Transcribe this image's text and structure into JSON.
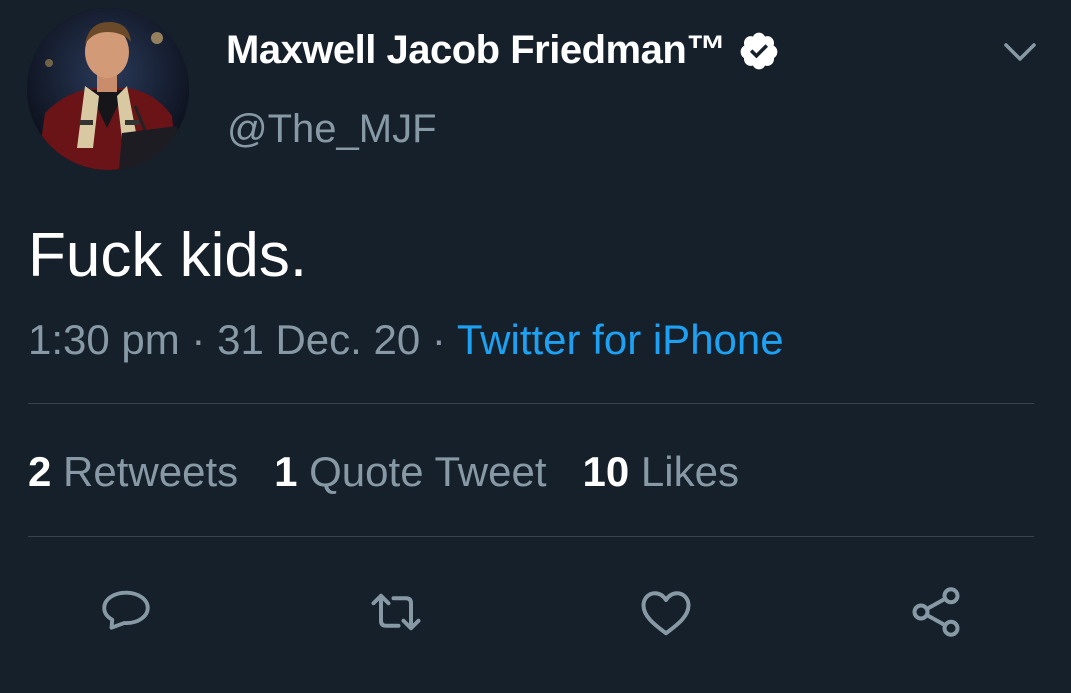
{
  "author": {
    "display_name": "Maxwell Jacob Friedman™",
    "handle": "@The_MJF",
    "verified": true,
    "avatar": "avatar-photo"
  },
  "tweet": {
    "text": "Fuck kids.",
    "time": "1:30 pm",
    "date": "31 Dec. 20",
    "separator": " · ",
    "source": "Twitter for iPhone"
  },
  "stats": {
    "retweets": {
      "count": "2",
      "label": "Retweets"
    },
    "quote_tweets": {
      "count": "1",
      "label": "Quote Tweet"
    },
    "likes": {
      "count": "10",
      "label": "Likes"
    }
  },
  "actions": [
    {
      "icon": "reply-icon"
    },
    {
      "icon": "retweet-icon"
    },
    {
      "icon": "like-icon"
    },
    {
      "icon": "share-icon"
    }
  ],
  "colors": {
    "background": "#15202b",
    "secondary_text": "#8899a6",
    "link": "#1da1f2",
    "divider": "#38444d"
  }
}
